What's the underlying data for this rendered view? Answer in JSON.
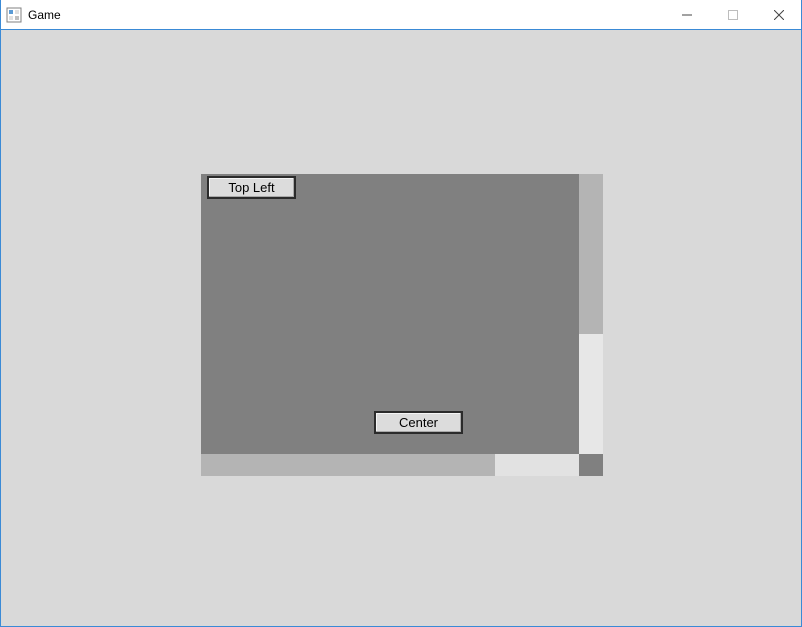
{
  "window": {
    "title": "Game"
  },
  "buttons": {
    "top_left": "Top Left",
    "center": "Center"
  },
  "blocks": {
    "a": "#808080",
    "b": "#b4b4b4",
    "c": "#e7e7e7",
    "d": "#b4b4b4",
    "e": "#e2e2e2",
    "f": "#808080"
  }
}
